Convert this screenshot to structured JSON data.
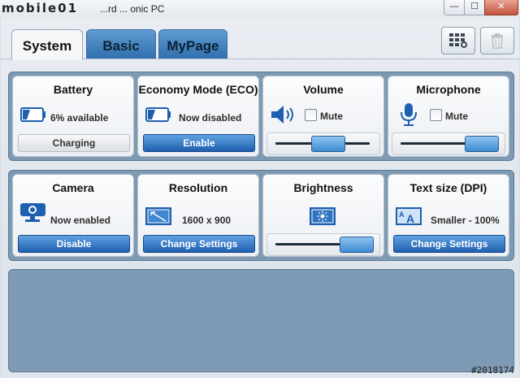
{
  "window": {
    "logo_text": "mobile01",
    "title": "...rd ... onic PC",
    "minimize": "—",
    "maximize": "☐",
    "close": "✕"
  },
  "tabs": [
    {
      "label": "System",
      "active": true
    },
    {
      "label": "Basic",
      "active": false
    },
    {
      "label": "MyPage",
      "active": false
    }
  ],
  "toolbar": {
    "settings_icon": "grid-settings-icon",
    "trash_icon": "trash-icon"
  },
  "row1": {
    "battery": {
      "title": "Battery",
      "status": "6% available",
      "button": "Charging",
      "level_percent": 6
    },
    "eco": {
      "title": "Economy Mode (ECO)",
      "status": "Now disabled",
      "button": "Enable"
    },
    "volume": {
      "title": "Volume",
      "mute_label": "Mute",
      "muted": false,
      "level_percent": 55
    },
    "microphone": {
      "title": "Microphone",
      "mute_label": "Mute",
      "muted": false,
      "level_percent": 85
    }
  },
  "row2": {
    "camera": {
      "title": "Camera",
      "status": "Now enabled",
      "button": "Disable"
    },
    "resolution": {
      "title": "Resolution",
      "status": "1600 x 900",
      "button": "Change Settings"
    },
    "brightness": {
      "title": "Brightness",
      "level_percent": 85
    },
    "textsize": {
      "title": "Text size (DPI)",
      "status": "Smaller - 100%",
      "button": "Change Settings"
    }
  },
  "watermark": "#2018174",
  "colors": {
    "accent_blue": "#1f5fb0",
    "panel_bg": "#7e9ab3",
    "tab_inactive": "#2f6fae"
  }
}
